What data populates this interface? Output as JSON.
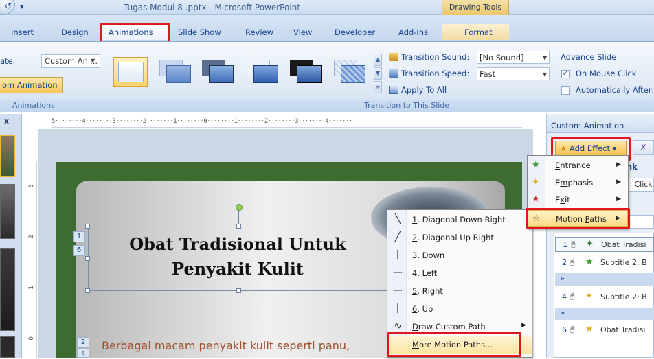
{
  "window": {
    "title": "Tugas Modul 8 .pptx - Microsoft PowerPoint",
    "contextual_tab_group": "Drawing Tools"
  },
  "tabs": [
    "Insert",
    "Design",
    "Animations",
    "Slide Show",
    "Review",
    "View",
    "Developer",
    "Add-Ins",
    "Format"
  ],
  "ribbon": {
    "animate_label": "ate:",
    "animate_value": "Custom Ani...",
    "custom_animation_button": "om Animation",
    "group_animations": "Animations",
    "group_transition": "Transition to This Slide",
    "transition_sound_label": "Transition Sound:",
    "transition_sound_value": "[No Sound]",
    "transition_speed_label": "Transition Speed:",
    "transition_speed_value": "Fast",
    "apply_to_all": "Apply To All",
    "advance_slide": "Advance Slide",
    "on_mouse_click": "On Mouse Click",
    "automatically_after": "Automatically After:"
  },
  "ruler": {
    "horizontal": "5········4········3········2········1········0········1········2········3········4········",
    "v3": "3",
    "v2": "2",
    "v1": "1",
    "v0": "0"
  },
  "left_pane": {
    "close": "x"
  },
  "slide": {
    "title_line1": "Obat Tradisional Untuk",
    "title_line2": "Penyakit Kulit",
    "tag1": "1",
    "tag6": "6",
    "tag2": "2",
    "tag4": "4",
    "body": "Berbagai macam penyakit kulit seperti panu,"
  },
  "motion_paths_menu": [
    {
      "icon": "diagonal-down-right",
      "mnemonic": "1",
      "label": ". Diagonal Down Right"
    },
    {
      "icon": "diagonal-up-right",
      "mnemonic": "2",
      "label": ". Diagonal Up Right"
    },
    {
      "icon": "down",
      "mnemonic": "3",
      "label": ". Down"
    },
    {
      "icon": "left",
      "mnemonic": "4",
      "label": ". Left"
    },
    {
      "icon": "right",
      "mnemonic": "5",
      "label": ". Right"
    },
    {
      "icon": "up",
      "mnemonic": "6",
      "label": ". Up"
    },
    {
      "icon": "draw-custom-path",
      "mnemonic": "D",
      "label": "raw Custom Path"
    },
    {
      "icon": "",
      "mnemonic": "M",
      "label": "ore Motion Paths..."
    }
  ],
  "task_pane": {
    "title": "Custom Animation",
    "add_effect": "Add Effect",
    "link": "ink",
    "start_value": "n Click",
    "h_value": "n",
    "add_effect_menu": [
      {
        "mnemonic": "E",
        "rest": "ntrance"
      },
      {
        "mnemonic": "m",
        "pre": "E",
        "rest": "phasis"
      },
      {
        "mnemonic": "x",
        "pre": "E",
        "rest": "it"
      },
      {
        "pre": "Motion ",
        "mnemonic": "P",
        "rest": "aths"
      }
    ],
    "effects": [
      {
        "num": "1",
        "name": "Obat Tradisi"
      },
      {
        "num": "2",
        "name": "Subtitle 2: B"
      },
      {
        "num": "4",
        "name": "Subtitle 2: B"
      },
      {
        "num": "6",
        "name": "Obat Tradisi"
      }
    ],
    "expand_glyph": "»"
  },
  "colors": {
    "highlight_red": "#e0161c",
    "slide_green": "#3d6b32",
    "ribbon_blue": "#15428b",
    "menu_hover": "#fcdc85"
  }
}
